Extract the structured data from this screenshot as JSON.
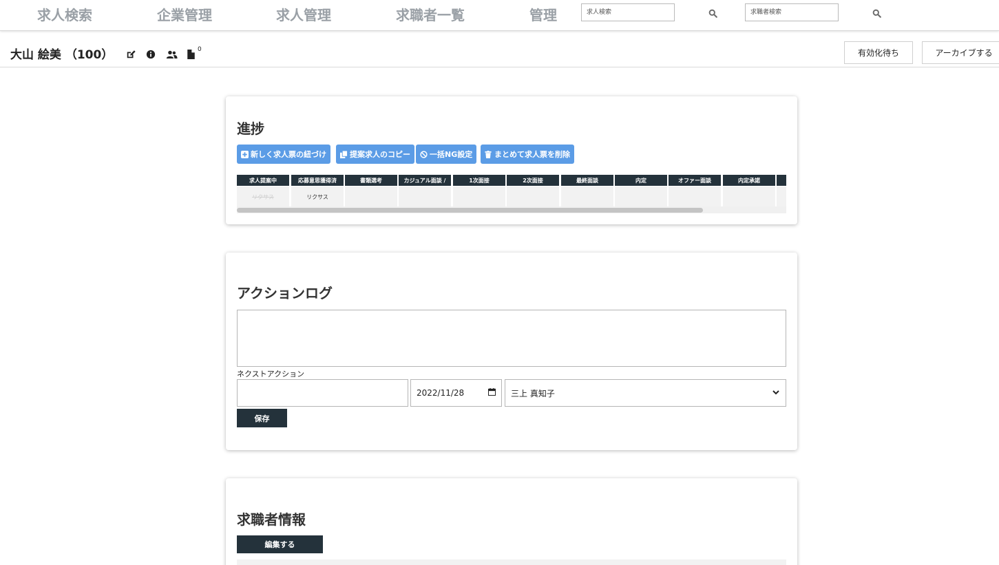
{
  "nav": {
    "links": [
      "求人検索",
      "企業管理",
      "求人管理",
      "求職者一覧",
      "管理"
    ],
    "job_search_placeholder": "求人検索",
    "seeker_search_placeholder": "求職者検索"
  },
  "header": {
    "name": "大山 絵美 （100）",
    "doc_count": "0",
    "pending_button": "有効化待ち",
    "archive_button": "アーカイブする"
  },
  "progress": {
    "title": "進捗",
    "buttons": [
      "新しく求人票の紐づけ",
      "提案求人のコピー",
      "一括NG設定",
      "まとめて求人票を削除"
    ],
    "columns": [
      "求人提案中",
      "応募意思獲得済",
      "書類選考",
      "カジュアル面談 /",
      "1次面接",
      "2次面接",
      "最終面談",
      "内定",
      "オファー面談",
      "内定承諾"
    ],
    "col0_item": "リクサス",
    "col1_item": "リクサス"
  },
  "action_log": {
    "title": "アクションログ",
    "next_action_label": "ネクストアクション",
    "next_action_value": "",
    "date_value": "2022/11/28",
    "assignee_value": "三上 真知子",
    "save_button": "保存"
  },
  "seeker_info": {
    "title": "求職者情報",
    "edit_button": "編集する"
  },
  "colors": {
    "accent_blue": "#5b9ce6",
    "dark": "#24323b",
    "nav_text": "#9aa0a6"
  }
}
